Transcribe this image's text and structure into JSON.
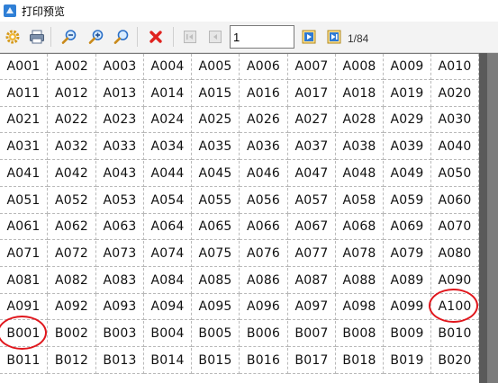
{
  "window": {
    "title": "打印预览"
  },
  "toolbar": {
    "settings_icon": "gear-icon",
    "print_icon": "printer-icon",
    "zoom_out_icon": "zoom-out-icon",
    "zoom_in_icon": "zoom-in-icon",
    "zoom_fit_icon": "zoom-fit-icon",
    "close_icon": "close-icon",
    "first_page_icon": "first-page-icon",
    "prev_page_icon": "prev-page-icon",
    "next_page_icon": "next-page-icon",
    "last_page_icon": "last-page-icon",
    "page_value": "1",
    "page_count": "1/84",
    "accent_red": "#e0161c"
  },
  "labels": {
    "rows": [
      [
        "A001",
        "A002",
        "A003",
        "A004",
        "A005",
        "A006",
        "A007",
        "A008",
        "A009",
        "A010"
      ],
      [
        "A011",
        "A012",
        "A013",
        "A014",
        "A015",
        "A016",
        "A017",
        "A018",
        "A019",
        "A020"
      ],
      [
        "A021",
        "A022",
        "A023",
        "A024",
        "A025",
        "A026",
        "A027",
        "A028",
        "A029",
        "A030"
      ],
      [
        "A031",
        "A032",
        "A033",
        "A034",
        "A035",
        "A036",
        "A037",
        "A038",
        "A039",
        "A040"
      ],
      [
        "A041",
        "A042",
        "A043",
        "A044",
        "A045",
        "A046",
        "A047",
        "A048",
        "A049",
        "A050"
      ],
      [
        "A051",
        "A052",
        "A053",
        "A054",
        "A055",
        "A056",
        "A057",
        "A058",
        "A059",
        "A060"
      ],
      [
        "A061",
        "A062",
        "A063",
        "A064",
        "A065",
        "A066",
        "A067",
        "A068",
        "A069",
        "A070"
      ],
      [
        "A071",
        "A072",
        "A073",
        "A074",
        "A075",
        "A076",
        "A077",
        "A078",
        "A079",
        "A080"
      ],
      [
        "A081",
        "A082",
        "A083",
        "A084",
        "A085",
        "A086",
        "A087",
        "A088",
        "A089",
        "A090"
      ],
      [
        "A091",
        "A092",
        "A093",
        "A094",
        "A095",
        "A096",
        "A097",
        "A098",
        "A099",
        "A100"
      ],
      [
        "B001",
        "B002",
        "B003",
        "B004",
        "B005",
        "B006",
        "B007",
        "B008",
        "B009",
        "B010"
      ],
      [
        "B011",
        "B012",
        "B013",
        "B014",
        "B015",
        "B016",
        "B017",
        "B018",
        "B019",
        "B020"
      ]
    ],
    "highlighted": [
      "A100",
      "B001"
    ]
  }
}
